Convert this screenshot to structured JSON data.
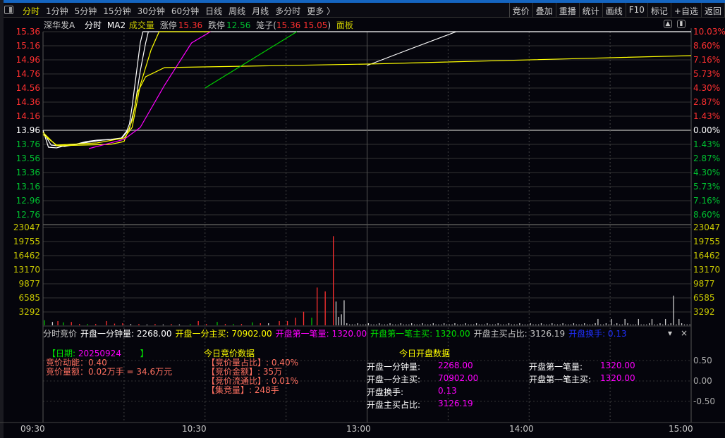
{
  "menu": {
    "periods": [
      "分时",
      "1分钟",
      "5分钟",
      "15分钟",
      "30分钟",
      "60分钟",
      "日线",
      "周线",
      "月线",
      "多分时",
      "更多 〉"
    ],
    "active": 0,
    "tools": [
      "竞价",
      "叠加",
      "重播",
      "统计",
      "画线",
      "F10",
      "标记",
      "+自选",
      "返回"
    ]
  },
  "info": {
    "stock": "深华发A",
    "mode": "分时",
    "ma": "MA2",
    "volume_label": "成交量",
    "limit_up_label": "涨停",
    "limit_up": "15.36",
    "limit_down_label": "跌停",
    "limit_down": "12.56",
    "cage_label": "笼子(",
    "cage_values": "15.36 15.05",
    "cage_close": ")",
    "panel_label": "面板"
  },
  "colors": {
    "up": "#ff3030",
    "down": "#00c000",
    "flat": "#ffffff",
    "yellow": "#e0e000",
    "magenta": "#ff00ff",
    "volaxis": "#c8c800"
  },
  "chart_data": {
    "type": "line",
    "price_axis": {
      "min": 12.76,
      "max": 15.36,
      "prev_close": 13.96,
      "ticks": [
        "15.36",
        "15.16",
        "14.96",
        "14.76",
        "14.56",
        "14.36",
        "14.16",
        "13.96",
        "13.76",
        "13.56",
        "13.36",
        "13.16",
        "12.96",
        "12.76"
      ]
    },
    "pct_ticks": [
      "10.03%",
      "8.60%",
      "7.16%",
      "5.73%",
      "4.30%",
      "2.87%",
      "1.43%",
      "0.00%",
      "1.43%",
      "2.87%",
      "4.30%",
      "5.73%",
      "7.16%",
      "8.60%"
    ],
    "volume_ticks": [
      "23047",
      "19755",
      "16462",
      "13170",
      "9877",
      "6585",
      "3292"
    ],
    "volume_max": 23047,
    "time_labels": [
      "09:30",
      "10:30",
      "13:00",
      "14:00",
      "15:00"
    ],
    "series": [
      {
        "name": "price",
        "color": "#ffffff",
        "points": [
          [
            0,
            13.96
          ],
          [
            2,
            13.72
          ],
          [
            5,
            13.71
          ],
          [
            8,
            13.74
          ],
          [
            12,
            13.76
          ],
          [
            16,
            13.8
          ],
          [
            20,
            13.82
          ],
          [
            25,
            13.83
          ],
          [
            29,
            13.85
          ],
          [
            31,
            13.95
          ],
          [
            32,
            14.05
          ],
          [
            33,
            14.3
          ],
          [
            34,
            14.6
          ],
          [
            35,
            14.9
          ],
          [
            36,
            15.2
          ],
          [
            37,
            15.36
          ],
          [
            120,
            15.36
          ],
          [
            240,
            15.36
          ]
        ]
      },
      {
        "name": "price2",
        "color": "#ffffff",
        "points": [
          [
            0,
            13.94
          ],
          [
            3,
            13.75
          ],
          [
            8,
            13.73
          ],
          [
            15,
            13.78
          ],
          [
            22,
            13.82
          ],
          [
            29,
            13.84
          ],
          [
            32,
            13.98
          ],
          [
            34,
            14.3
          ],
          [
            36,
            14.8
          ],
          [
            38,
            15.2
          ],
          [
            39,
            15.36
          ]
        ]
      },
      {
        "name": "price3",
        "color": "#ffffff",
        "points": [
          [
            120,
            14.88
          ],
          [
            135,
            15.1
          ],
          [
            153,
            15.36
          ]
        ]
      },
      {
        "name": "ma_fast",
        "color": "#ffff00",
        "points": [
          [
            0,
            13.9
          ],
          [
            5,
            13.75
          ],
          [
            20,
            13.78
          ],
          [
            30,
            13.85
          ],
          [
            33,
            14.0
          ],
          [
            36,
            14.6
          ],
          [
            40,
            15.1
          ],
          [
            43,
            15.36
          ],
          [
            62,
            15.36
          ]
        ]
      },
      {
        "name": "avg",
        "color": "#ffff00",
        "points": [
          [
            0,
            13.93
          ],
          [
            5,
            13.74
          ],
          [
            25,
            13.76
          ],
          [
            30,
            13.8
          ],
          [
            33,
            14.1
          ],
          [
            35,
            14.5
          ],
          [
            38,
            14.72
          ],
          [
            45,
            14.85
          ],
          [
            120,
            14.9
          ],
          [
            240,
            15.02
          ]
        ]
      },
      {
        "name": "ma_slow",
        "color": "#ff00ff",
        "points": [
          [
            17,
            13.7
          ],
          [
            30,
            13.83
          ],
          [
            36,
            14.0
          ],
          [
            45,
            14.6
          ],
          [
            55,
            15.2
          ],
          [
            62,
            15.36
          ]
        ]
      },
      {
        "name": "ma_green",
        "color": "#00d000",
        "points": [
          [
            60,
            14.56
          ],
          [
            94,
            15.36
          ]
        ]
      }
    ],
    "volume_bars": [
      [
        0,
        1200,
        "g"
      ],
      [
        3,
        800,
        "w"
      ],
      [
        5,
        1000,
        "r"
      ],
      [
        7,
        700,
        "g"
      ],
      [
        10,
        800,
        "r"
      ],
      [
        13,
        300,
        "r"
      ],
      [
        16,
        300,
        "g"
      ],
      [
        19,
        300,
        "r"
      ],
      [
        23,
        1000,
        "r"
      ],
      [
        26,
        400,
        "r"
      ],
      [
        29,
        500,
        "r"
      ],
      [
        32,
        300,
        "w"
      ],
      [
        35,
        300,
        "r"
      ],
      [
        38,
        200,
        "w"
      ],
      [
        41,
        300,
        "r"
      ],
      [
        44,
        200,
        "w"
      ],
      [
        47,
        300,
        "r"
      ],
      [
        50,
        200,
        "w"
      ],
      [
        54,
        300,
        "g"
      ],
      [
        57,
        1000,
        "r"
      ],
      [
        60,
        300,
        "r"
      ],
      [
        64,
        800,
        "g"
      ],
      [
        67,
        300,
        "r"
      ],
      [
        70,
        300,
        "g"
      ],
      [
        73,
        300,
        "r"
      ],
      [
        77,
        700,
        "g"
      ],
      [
        80,
        500,
        "r"
      ],
      [
        83,
        500,
        "w"
      ],
      [
        87,
        1000,
        "r"
      ],
      [
        90,
        1000,
        "r"
      ],
      [
        93,
        1800,
        "r"
      ],
      [
        96,
        3200,
        "r"
      ],
      [
        99,
        1800,
        "g"
      ],
      [
        101,
        8900,
        "r"
      ],
      [
        104,
        8000,
        "r"
      ],
      [
        107,
        21000,
        "r"
      ]
    ],
    "volume_bars_pm": []
  },
  "bottom": {
    "header": [
      {
        "t": "分时竞价",
        "c": "#c8c8c8"
      },
      {
        "t": "开盘一分钟量: 2268.00",
        "c": "#ffffff"
      },
      {
        "t": "开盘一分主买: 70902.00",
        "c": "#ffff00"
      },
      {
        "t": "开盘第一笔量: 1320.00",
        "c": "#ff00ff"
      },
      {
        "t": "开盘第一笔主买: 1320.00",
        "c": "#00e000"
      },
      {
        "t": "开盘主买占比: 3126.19",
        "c": "#c8c8c8"
      },
      {
        "t": "开盘换手: 0.13",
        "c": "#2030ff"
      }
    ],
    "date_open": "【日期:",
    "date": "20250924",
    "date_close": "】",
    "auction_energy": "竞价动能：0.40",
    "auction_amount": "竞价量额：0.02万手 = 34.6万元",
    "today_auction_title": "今日竞价数据",
    "today_auction": [
      "【竞价量占比】: 0.40%",
      "【竞价金额】: 35万",
      "【竞价流通比】: 0.01%",
      "【集竞量】: 248手"
    ],
    "today_open_title": "今日开盘数据",
    "open_rows": [
      {
        "k": "开盘一分钟量:",
        "v": "2268.00"
      },
      {
        "k": "开盘一分主买:",
        "v": "70902.00"
      },
      {
        "k": "开盘换手:",
        "v": "0.13"
      },
      {
        "k": "开盘主买占比:",
        "v": "3126.19"
      }
    ],
    "open_rows2": [
      {
        "k": "开盘第一笔量:",
        "v": "1320.00"
      },
      {
        "k": "开盘第一笔主买:",
        "v": "1320.00"
      }
    ],
    "axis": [
      "0.50",
      "0.00",
      "-0.50"
    ]
  }
}
